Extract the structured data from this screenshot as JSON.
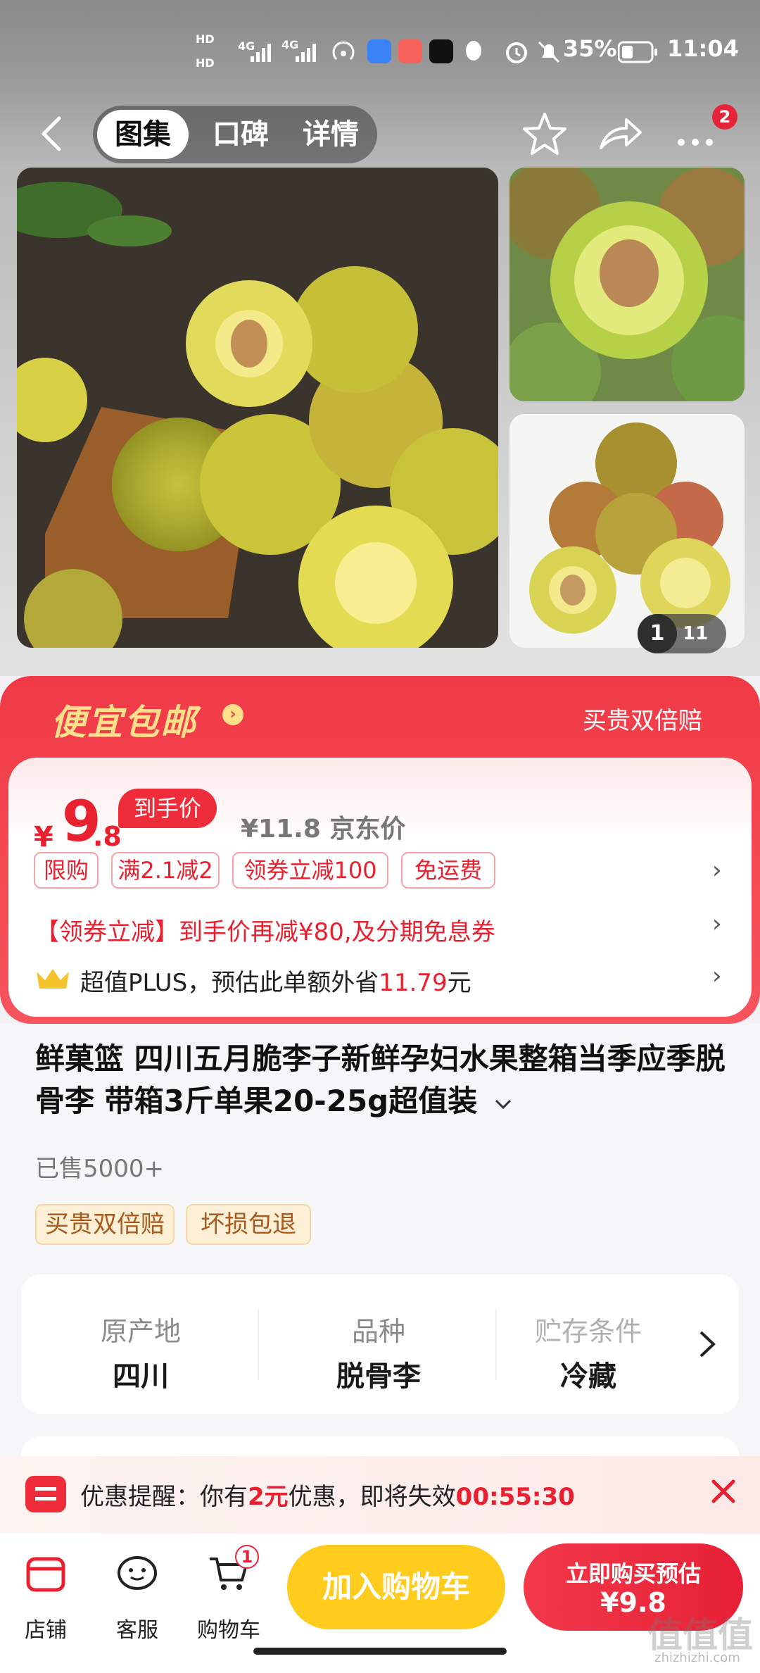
{
  "status_bar": {
    "hd1": "HD",
    "hd2": "HD",
    "net1": "4G",
    "net2": "4G",
    "battery": "35%",
    "time": "11:04"
  },
  "nav": {
    "tabs": [
      {
        "label": "图集"
      },
      {
        "label": "口碑"
      },
      {
        "label": "详情"
      }
    ],
    "more_badge": "2"
  },
  "gallery": {
    "current_page": "1",
    "total_pages": "11"
  },
  "promo": {
    "title": "便宜包邮",
    "right_label": "买贵双倍赔",
    "price_symbol": "¥",
    "price_int": "9",
    "price_dec": ".8",
    "price_tag": "到手价",
    "old_price": "¥11.8 京东价",
    "tags": [
      "限购",
      "满2.1减2",
      "领券立减100",
      "免运费"
    ],
    "coupon_line": "【领券立减】到手价再减¥80,及分期免息券",
    "plus_prefix": "超值PLUS，预估此单额外省",
    "plus_amount": "11.79",
    "plus_suffix": "元"
  },
  "product": {
    "title": "鲜菓篮 四川五月脆李子新鲜孕妇水果整箱当季应季脱骨李 带箱3斤单果20-25g超值装",
    "sold": "已售5000+",
    "guarantee_tags": [
      "买贵双倍赔",
      "坏损包退"
    ],
    "specs": [
      {
        "key": "原产地",
        "value": "四川"
      },
      {
        "key": "品种",
        "value": "脱骨李"
      },
      {
        "key": "贮存条件",
        "value": "冷藏"
      }
    ]
  },
  "reminder": {
    "prefix": "优惠提醒：你有",
    "amount": "2元",
    "middle": "优惠，即将失效",
    "countdown": "00:55:30"
  },
  "bottom_bar": {
    "shop": "店铺",
    "service": "客服",
    "cart": "购物车",
    "cart_badge": "1",
    "add_to_cart": "加入购物车",
    "buy_line1": "立即购买预估",
    "buy_line2": "¥9.8"
  },
  "watermark": {
    "text": "值值值",
    "sub": "zhizhizhi.com"
  },
  "colors": {
    "accent_red": "#e8202f",
    "cart_yellow": "#ffcc1d",
    "promo_gold": "#ffe08a"
  }
}
